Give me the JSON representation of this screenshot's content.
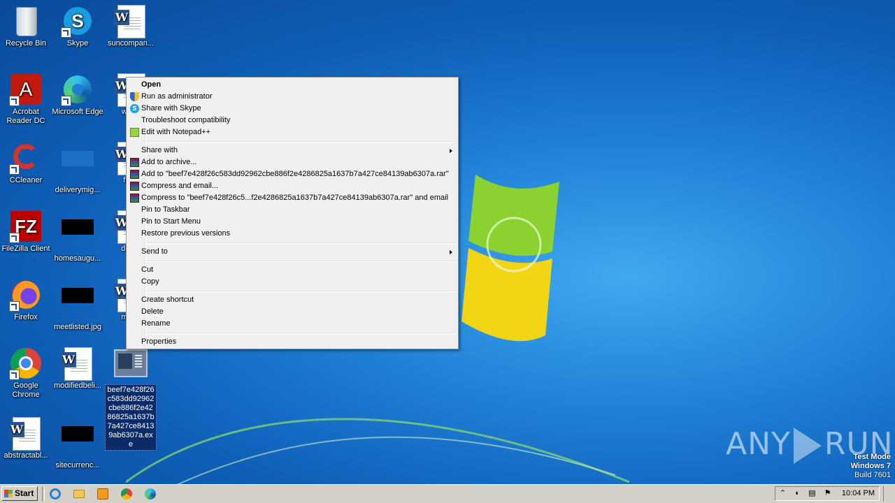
{
  "desktop": {
    "icons": [
      {
        "label": "Recycle Bin"
      },
      {
        "label": "Skype"
      },
      {
        "label": "suncompan..."
      },
      {
        "label": "Acrobat Reader DC"
      },
      {
        "label": "Microsoft Edge"
      },
      {
        "label": "wedd"
      },
      {
        "label": "CCleaner"
      },
      {
        "label": "deliverymig..."
      },
      {
        "label": "figur"
      },
      {
        "label": "FileZilla Client"
      },
      {
        "label": "homesaugu..."
      },
      {
        "label": "death"
      },
      {
        "label": "Firefox"
      },
      {
        "label": "meetlisted.jpg"
      },
      {
        "label": "marja"
      },
      {
        "label": "Google Chrome"
      },
      {
        "label": "modifiedbeli..."
      },
      {
        "label": "abstractabl..."
      },
      {
        "label": "sitecurrenc..."
      }
    ],
    "selected_file": "beef7e428f26c583dd92962cbe886f2e4286825a1637b7a427ce84139ab6307a.exe"
  },
  "context_menu": {
    "open": "Open",
    "run_as_admin": "Run as administrator",
    "share_skype": "Share with Skype",
    "troubleshoot": "Troubleshoot compatibility",
    "edit_npp": "Edit with Notepad++",
    "share_with": "Share with",
    "add_archive": "Add to archive...",
    "add_to_rar": "Add to \"beef7e428f26c583dd92962cbe886f2e4286825a1637b7a427ce84139ab6307a.rar\"",
    "compress_email": "Compress and email...",
    "compress_to_rar_email": "Compress to \"beef7e428f26c5...f2e4286825a1637b7a427ce84139ab6307a.rar\" and email",
    "pin_taskbar": "Pin to Taskbar",
    "pin_start": "Pin to Start Menu",
    "restore": "Restore previous versions",
    "send_to": "Send to",
    "cut": "Cut",
    "copy": "Copy",
    "create_shortcut": "Create shortcut",
    "delete": "Delete",
    "rename": "Rename",
    "properties": "Properties"
  },
  "watermark": {
    "brand_left": "ANY",
    "brand_right": "RUN",
    "test_mode": "Test Mode",
    "os": "Windows 7",
    "build": "Build 7601"
  },
  "taskbar": {
    "start_label": "Start",
    "time": "10:04 PM"
  }
}
